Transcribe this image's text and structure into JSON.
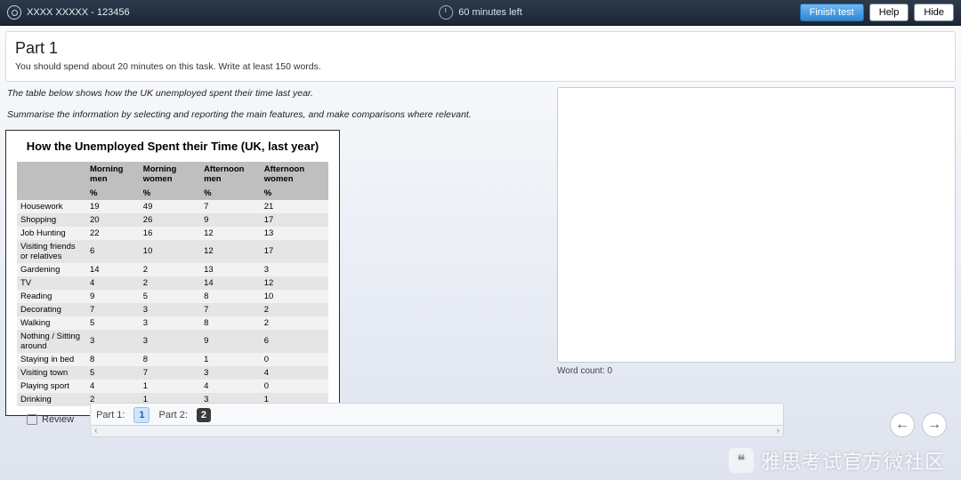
{
  "header": {
    "user_label": "XXXX XXXXX - 123456",
    "timer_text": "60 minutes left",
    "buttons": {
      "finish": "Finish test",
      "help": "Help",
      "hide": "Hide"
    }
  },
  "part": {
    "title": "Part 1",
    "instructions": "You should spend about 20 minutes on this task. Write at least 150 words."
  },
  "question": {
    "line1": "The table below shows how the UK unemployed spent their time last year.",
    "line2": "Summarise the information by selecting and reporting the main features, and make comparisons where relevant."
  },
  "chart_data": {
    "type": "table",
    "title": "How the Unemployed Spent their Time (UK, last year)",
    "columns": [
      "",
      "Morning men",
      "Morning women",
      "Afternoon men",
      "Afternoon women"
    ],
    "unit_row": [
      "",
      "%",
      "%",
      "%",
      "%"
    ],
    "rows": [
      {
        "activity": "Housework",
        "values": [
          19,
          49,
          7,
          21
        ]
      },
      {
        "activity": "Shopping",
        "values": [
          20,
          26,
          9,
          17
        ]
      },
      {
        "activity": "Job Hunting",
        "values": [
          22,
          16,
          12,
          13
        ]
      },
      {
        "activity": "Visiting friends or relatives",
        "values": [
          6,
          10,
          12,
          17
        ]
      },
      {
        "activity": "Gardening",
        "values": [
          14,
          2,
          13,
          3
        ]
      },
      {
        "activity": "TV",
        "values": [
          4,
          2,
          14,
          12
        ]
      },
      {
        "activity": "Reading",
        "values": [
          9,
          5,
          8,
          10
        ]
      },
      {
        "activity": "Decorating",
        "values": [
          7,
          3,
          7,
          2
        ]
      },
      {
        "activity": "Walking",
        "values": [
          5,
          3,
          8,
          2
        ]
      },
      {
        "activity": "Nothing / Sitting around",
        "values": [
          3,
          3,
          9,
          6
        ]
      },
      {
        "activity": "Staying in bed",
        "values": [
          8,
          8,
          1,
          0
        ]
      },
      {
        "activity": "Visiting town",
        "values": [
          5,
          7,
          3,
          4
        ]
      },
      {
        "activity": "Playing sport",
        "values": [
          4,
          1,
          4,
          0
        ]
      },
      {
        "activity": "Drinking",
        "values": [
          2,
          1,
          3,
          1
        ]
      }
    ]
  },
  "answer": {
    "word_count_label": "Word count:",
    "word_count": 0,
    "placeholder": ""
  },
  "nav": {
    "part1_label": "Part 1:",
    "part2_label": "Part 2:",
    "q1": "1",
    "q2": "2",
    "review_label": "Review",
    "left": "‹",
    "right": "›"
  },
  "watermark": "雅思考试官方微社区"
}
